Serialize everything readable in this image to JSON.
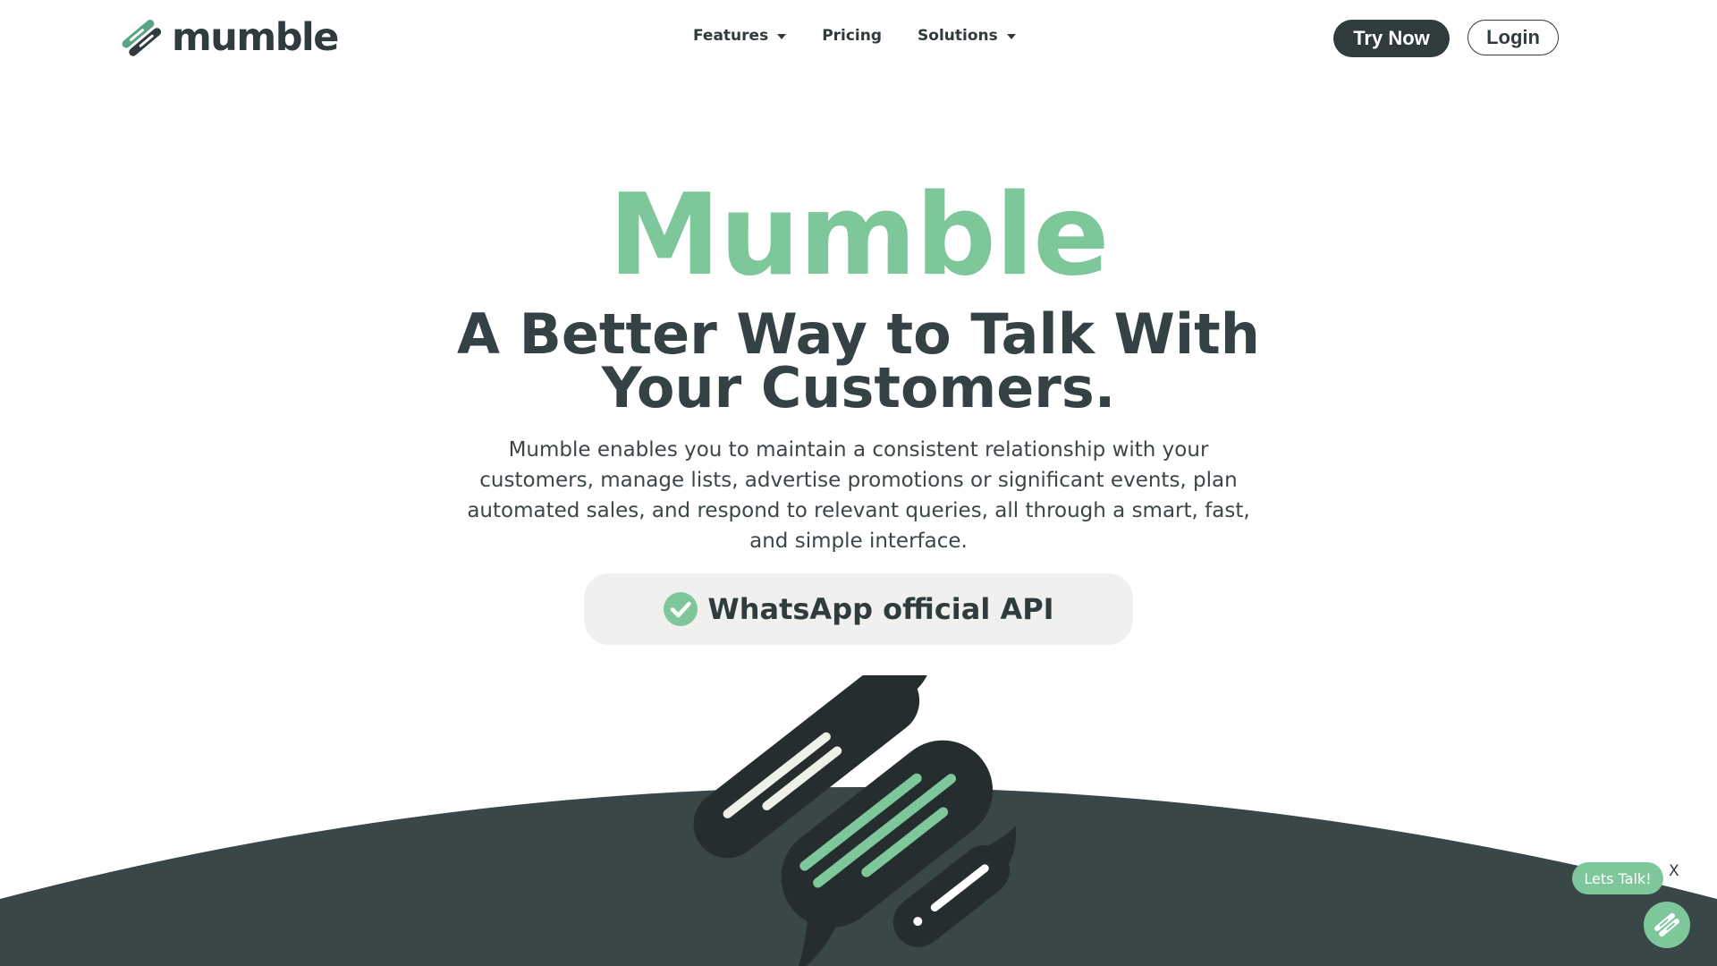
{
  "header": {
    "logo_text": "mumble",
    "nav": [
      {
        "label": "Features",
        "has_dropdown": true
      },
      {
        "label": "Pricing",
        "has_dropdown": false
      },
      {
        "label": "Solutions",
        "has_dropdown": true
      }
    ],
    "try_now_label": "Try Now",
    "login_label": "Login"
  },
  "hero": {
    "brand": "Mumble",
    "title": "A Better Way to Talk With Your Customers.",
    "description": "Mumble enables you to maintain a consistent relationship with your customers, manage lists, advertise promotions or significant events, plan automated sales, and respond to relevant queries, all through a smart, fast, and simple interface.",
    "badge_label": "WhatsApp official API"
  },
  "chat_widget": {
    "bubble_label": "Lets Talk!",
    "close_label": "X"
  },
  "icons": [
    "logo-icon",
    "chevron-down-icon",
    "check-circle-icon",
    "chat-illustration",
    "chat-launcher-icon"
  ],
  "colors": {
    "accent_green": "#7ec79b",
    "dark": "#2f3b3d",
    "arc": "#3a4749",
    "badge_bg": "#f0f1ef"
  }
}
